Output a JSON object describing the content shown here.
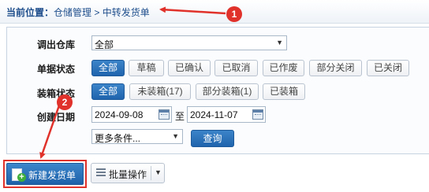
{
  "breadcrumb": {
    "prefix": "当前位置：",
    "path": "仓储管理 > 中转发货单"
  },
  "filters": {
    "warehouse": {
      "label": "调出仓库",
      "value": "全部"
    },
    "doc_status": {
      "label": "单据状态",
      "options": [
        "全部",
        "草稿",
        "已确认",
        "已取消",
        "已作废",
        "部分关闭",
        "已关闭"
      ],
      "selected": "全部"
    },
    "pack_status": {
      "label": "装箱状态",
      "options": [
        "全部",
        "未装箱(17)",
        "部分装箱(1)",
        "已装箱"
      ],
      "selected": "全部"
    },
    "created_date": {
      "label": "创建日期",
      "from": "2024-09-08",
      "to_label": "至",
      "to": "2024-11-07"
    },
    "more": {
      "value": "更多条件..."
    },
    "query_label": "查询"
  },
  "actions": {
    "new_label": "新建发货单",
    "batch_label": "批量操作"
  },
  "annotations": {
    "step1": "1",
    "step2": "2",
    "color": "#e0312b"
  }
}
